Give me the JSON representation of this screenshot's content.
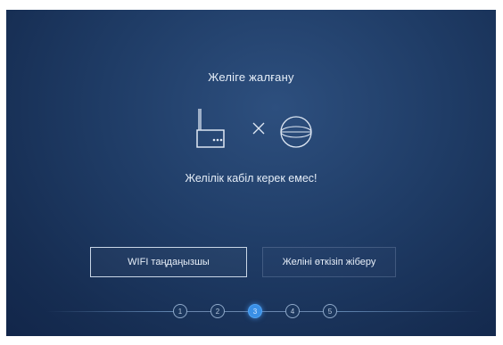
{
  "header": {
    "title": "Желіге жалғану"
  },
  "illustration": {
    "router_icon": "router-icon",
    "separator_icon": "x-icon",
    "globe_icon": "globe-icon"
  },
  "message": {
    "text": "Желілік кабіл керек емес!"
  },
  "buttons": {
    "select_wifi": "WIFI таңдаңызшы",
    "skip_network": "Желіні өткізіп жіберу"
  },
  "stepper": {
    "steps": [
      "1",
      "2",
      "3",
      "4",
      "5"
    ],
    "current_step": 3
  },
  "colors": {
    "background": "#1f3c66",
    "accent": "#3a8fe6",
    "text": "#e6eef8"
  }
}
